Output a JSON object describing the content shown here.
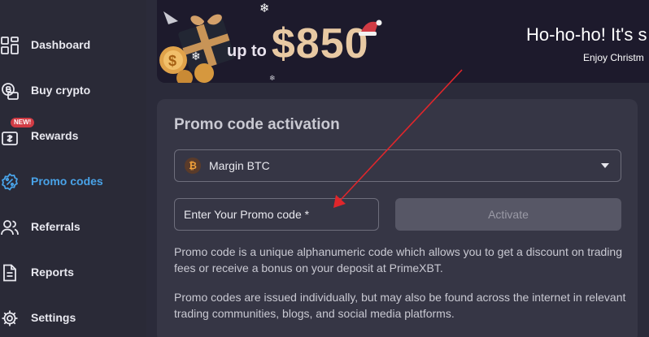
{
  "sidebar": {
    "items": [
      {
        "label": "Dashboard",
        "icon": "dashboard-icon"
      },
      {
        "label": "Buy crypto",
        "icon": "wallet-bitcoin-icon"
      },
      {
        "label": "Rewards",
        "icon": "rewards-gift-icon",
        "badge": "NEW!"
      },
      {
        "label": "Promo codes",
        "icon": "promo-percent-icon",
        "active": true
      },
      {
        "label": "Referrals",
        "icon": "users-icon"
      },
      {
        "label": "Reports",
        "icon": "document-icon"
      },
      {
        "label": "Settings",
        "icon": "gear-icon"
      }
    ],
    "active_color": "#49a3e8"
  },
  "banner": {
    "up_to": "up to",
    "amount": "$850",
    "title": "Ho-ho-ho! It's s",
    "subtitle": "Enjoy Christm"
  },
  "promo": {
    "title": "Promo code activation",
    "account_select": {
      "value": "Margin BTC",
      "icon": "bitcoin-icon"
    },
    "input": {
      "placeholder": "Enter Your Promo code *",
      "value": ""
    },
    "activate_label": "Activate",
    "description_1": "Promo code is a unique alphanumeric code which allows you to get a discount on trading fees or receive a bonus on your deposit at PrimeXBT.",
    "description_2": "Promo codes are issued individually, but may also be found across the internet in relevant trading communities, blogs, and social media platforms."
  },
  "colors": {
    "background": "#2b2b3a",
    "card": "#363645",
    "annotation_arrow": "#e0262b",
    "banner_amount": "#e8c9a3"
  }
}
